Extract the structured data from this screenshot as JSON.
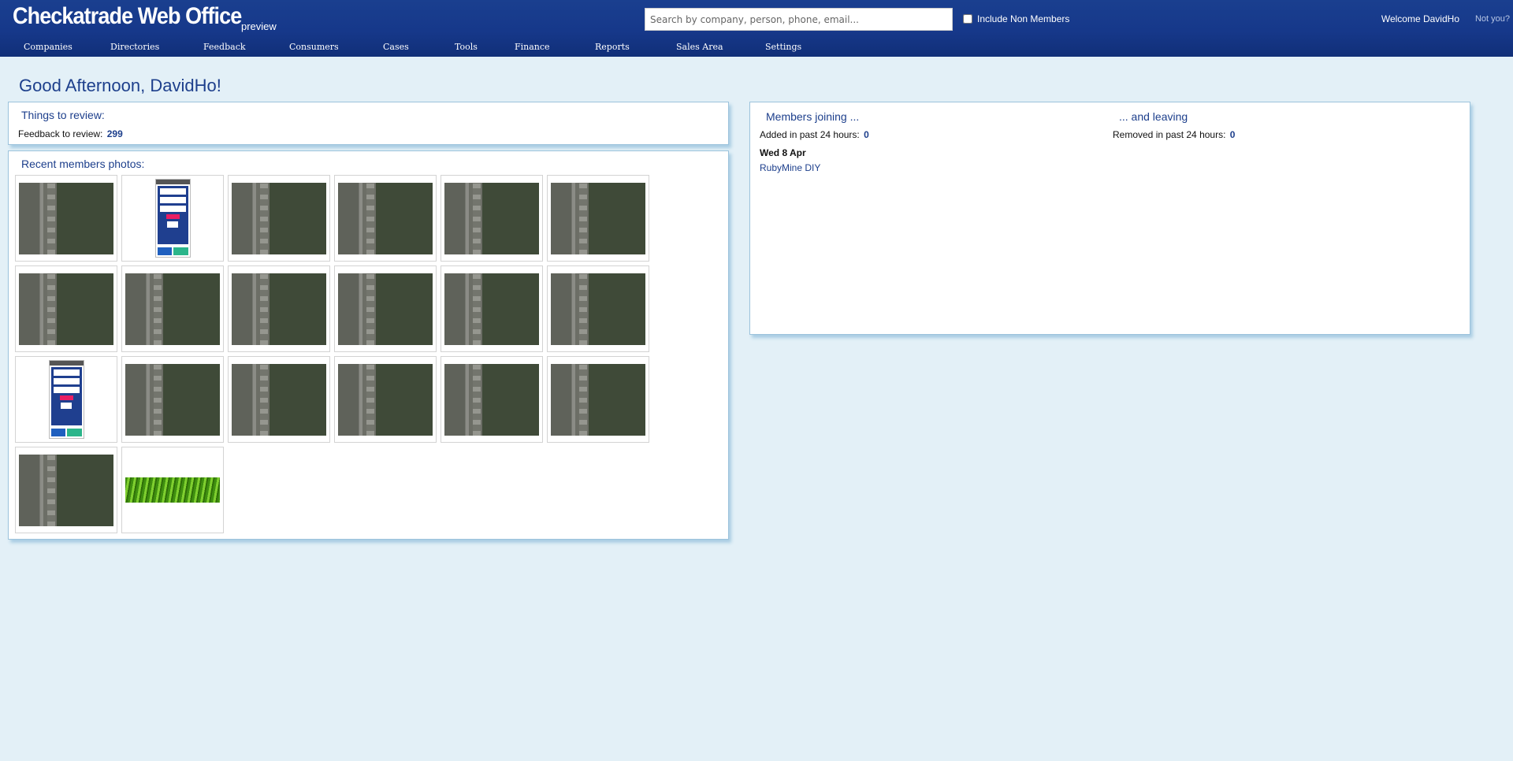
{
  "header": {
    "brand": "Checkatrade Web Office",
    "preview": "preview",
    "search_placeholder": "Search by company, person, phone, email...",
    "include_non_members": "Include Non Members",
    "welcome": "Welcome DavidHo",
    "not_you": "Not you?"
  },
  "nav": [
    "Companies",
    "Directories",
    "Feedback",
    "Consumers",
    "Cases",
    "Tools",
    "Finance",
    "Reports",
    "Sales Area",
    "Settings"
  ],
  "greeting": "Good Afternoon, DavidHo!",
  "review": {
    "title": "Things to review:",
    "feedback_label": "Feedback to review:",
    "feedback_count": "299"
  },
  "photos": {
    "title": "Recent members photos:",
    "items": [
      "road",
      "phone",
      "road",
      "road",
      "road",
      "road",
      "road",
      "road",
      "road",
      "road",
      "road",
      "road",
      "phone",
      "road",
      "road",
      "road",
      "road",
      "road",
      "road",
      "grass"
    ]
  },
  "members": {
    "joining_title": "Members joining ...",
    "added_label": "Added in past 24 hours:",
    "added_count": "0",
    "date": "Wed 8 Apr",
    "company": "RubyMine DIY",
    "leaving_title": "... and leaving",
    "removed_label": "Removed in past 24 hours:",
    "removed_count": "0"
  }
}
